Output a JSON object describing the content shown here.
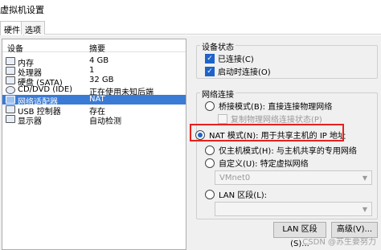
{
  "window": {
    "title": "虚拟机设置"
  },
  "tabs": [
    {
      "label": "硬件",
      "active": true
    },
    {
      "label": "选项",
      "active": false
    }
  ],
  "device_list": {
    "headers": {
      "device": "设备",
      "summary": "摘要"
    },
    "rows": [
      {
        "icon": "memory-icon",
        "device": "内存",
        "summary": "4 GB",
        "selected": false
      },
      {
        "icon": "cpu-icon",
        "device": "处理器",
        "summary": "1",
        "selected": false
      },
      {
        "icon": "disk-icon",
        "device": "硬盘 (SATA)",
        "summary": "32 GB",
        "selected": false
      },
      {
        "icon": "cd-icon",
        "device": "CD/DVD (IDE)",
        "summary": "正在使用未知后端",
        "selected": false
      },
      {
        "icon": "network-icon",
        "device": "网络适配器",
        "summary": "NAT",
        "selected": true
      },
      {
        "icon": "usb-icon",
        "device": "USB 控制器",
        "summary": "存在",
        "selected": false
      },
      {
        "icon": "display-icon",
        "device": "显示器",
        "summary": "自动检测",
        "selected": false
      }
    ]
  },
  "device_status": {
    "title": "设备状态",
    "connected": {
      "label": "已连接(C)",
      "checked": true
    },
    "connect_on_power": {
      "label": "启动时连接(O)",
      "checked": true
    }
  },
  "network_connection": {
    "title": "网络连接",
    "bridged": {
      "label": "桥接模式(B): 直接连接物理网络",
      "selected": false
    },
    "replicate": {
      "label": "复制物理网络连接状态(P)",
      "checked": false
    },
    "nat": {
      "label": "NAT 模式(N): 用于共享主机的 IP 地址",
      "selected": true
    },
    "host_only": {
      "label": "仅主机模式(H): 与主机共享的专用网络",
      "selected": false
    },
    "custom": {
      "label": "自定义(U): 特定虚拟网络",
      "selected": false
    },
    "custom_select": {
      "value": "VMnet0"
    },
    "lan_segment": {
      "label": "LAN 区段(L):",
      "selected": false
    }
  },
  "buttons": {
    "lan_segments": "LAN 区段(S)...",
    "advanced": "高级(V)..."
  },
  "watermark": "CSDN @苏生要努力",
  "colors": {
    "accent": "#1e64c8",
    "selection": "#3a7bd5",
    "highlight_box": "#e8201c"
  }
}
